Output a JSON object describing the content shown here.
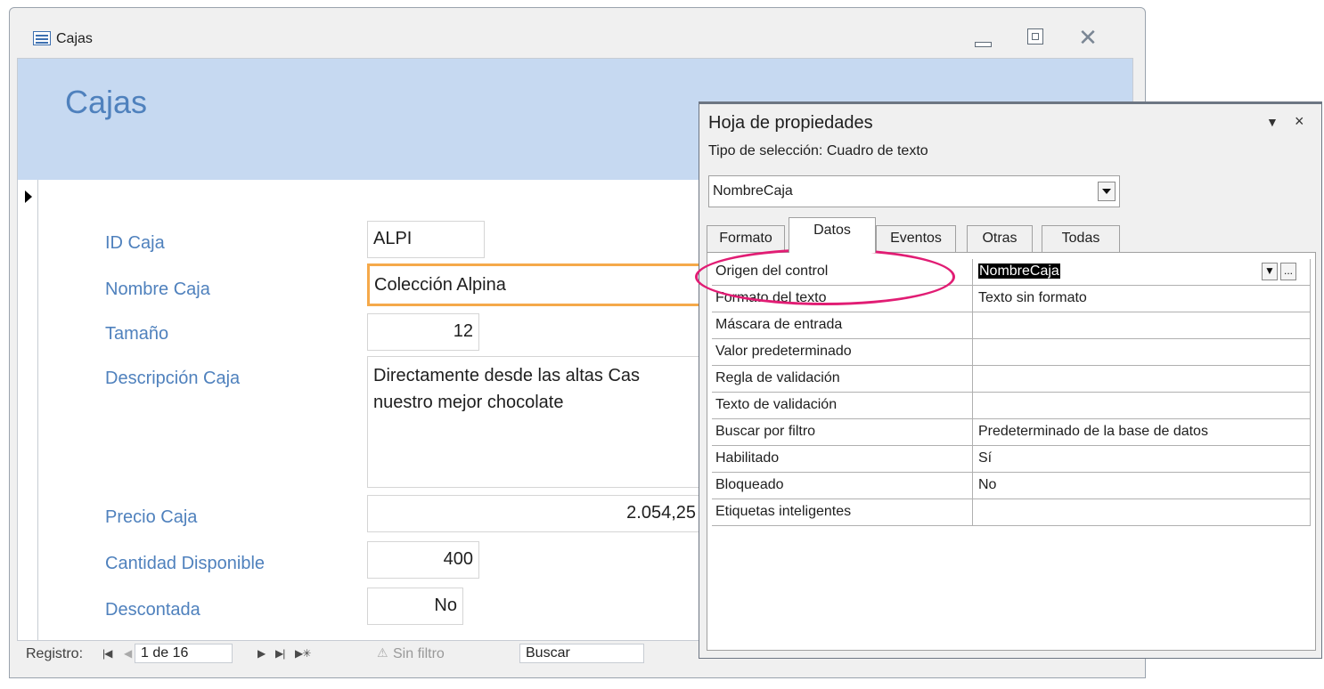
{
  "window": {
    "title": "Cajas"
  },
  "form": {
    "heading": "Cajas",
    "fields": [
      {
        "label": "ID Caja",
        "value": "ALPI"
      },
      {
        "label": "Nombre Caja",
        "value": "Colección Alpina"
      },
      {
        "label": "Tamaño",
        "value": "12"
      },
      {
        "label": "Descripción Caja",
        "value_line1": "Directamente desde las altas Cas",
        "value_line2": "nuestro mejor chocolate"
      },
      {
        "label": "Precio Caja",
        "value": "2.054,25"
      },
      {
        "label": "Cantidad Disponible",
        "value": "400"
      },
      {
        "label": "Descontada",
        "value": "No"
      }
    ]
  },
  "navigation": {
    "label": "Registro:",
    "record": "1 de 16",
    "filter": "Sin filtro",
    "search_placeholder": "Buscar"
  },
  "property_sheet": {
    "title": "Hoja de propiedades",
    "selection_type": "Tipo de selección: Cuadro de texto",
    "selected_control": "NombreCaja",
    "tabs": [
      "Formato",
      "Datos",
      "Eventos",
      "Otras",
      "Todas"
    ],
    "active_tab": "Datos",
    "rows": [
      {
        "name": "Origen del control",
        "value": "NombreCaja"
      },
      {
        "name": "Formato del texto",
        "value": "Texto sin formato"
      },
      {
        "name": "Máscara de entrada",
        "value": ""
      },
      {
        "name": "Valor predeterminado",
        "value": ""
      },
      {
        "name": "Regla de validación",
        "value": ""
      },
      {
        "name": "Texto de validación",
        "value": ""
      },
      {
        "name": "Buscar por filtro",
        "value": "Predeterminado de la base de datos"
      },
      {
        "name": "Habilitado",
        "value": "Sí"
      },
      {
        "name": "Bloqueado",
        "value": "No"
      },
      {
        "name": "Etiquetas inteligentes",
        "value": ""
      }
    ],
    "builder_button": "..."
  },
  "colors": {
    "label_blue": "#4f81bd",
    "header_bg": "#c6d9f1",
    "selected_field_border": "#f5a94a",
    "annotation_ellipse": "#e11d74"
  },
  "icons": [
    "form-icon",
    "minimize-icon",
    "maximize-icon",
    "close-icon",
    "record-selector-icon",
    "dropdown-arrow-icon",
    "pin-icon"
  ]
}
